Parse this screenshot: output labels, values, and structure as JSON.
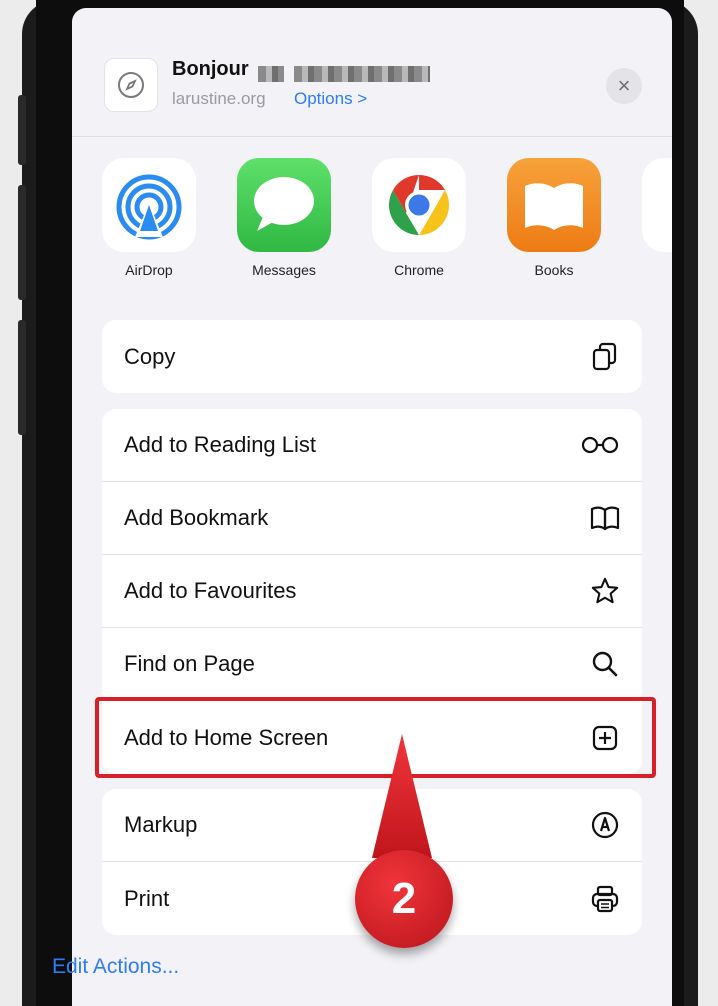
{
  "header": {
    "site_title": "Bonjour",
    "site_domain": "larustine.org",
    "options_label": "Options >",
    "close_glyph": "×"
  },
  "apps": [
    {
      "label": "AirDrop",
      "icon": "airdrop-icon"
    },
    {
      "label": "Messages",
      "icon": "messages-icon"
    },
    {
      "label": "Chrome",
      "icon": "chrome-icon"
    },
    {
      "label": "Books",
      "icon": "books-icon"
    }
  ],
  "actions_top": [
    {
      "label": "Copy",
      "icon": "copy-icon"
    }
  ],
  "actions_main": [
    {
      "label": "Add to Reading List",
      "icon": "glasses-icon"
    },
    {
      "label": "Add Bookmark",
      "icon": "book-icon"
    },
    {
      "label": "Add to Favourites",
      "icon": "star-icon"
    },
    {
      "label": "Find on Page",
      "icon": "search-icon"
    },
    {
      "label": "Add to Home Screen",
      "icon": "plus-square-icon"
    }
  ],
  "actions_bottom": [
    {
      "label": "Markup",
      "icon": "markup-icon"
    },
    {
      "label": "Print",
      "icon": "printer-icon"
    }
  ],
  "edit_actions_label": "Edit Actions...",
  "annotation": {
    "step_number": "2",
    "highlight_color": "#d72027"
  },
  "colors": {
    "link": "#2f7cf6",
    "airdrop": "#2a8cf0",
    "messages": "#3dc94e",
    "books": "#f08a1c"
  }
}
